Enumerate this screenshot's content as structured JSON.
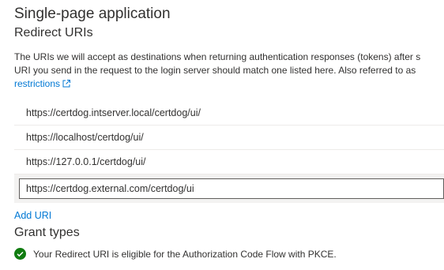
{
  "section": {
    "title": "Single-page application",
    "subtitle": "Redirect URIs"
  },
  "description": {
    "line1": "The URIs we will accept as destinations when returning authentication responses (tokens) after s",
    "line2": "URI you send in the request to the login server should match one listed here. Also referred to as",
    "link_text": "restrictions"
  },
  "redirect_uris": [
    "https://certdog.intserver.local/certdog/ui/",
    "https://localhost/certdog/ui/",
    "https://127.0.0.1/certdog/ui/"
  ],
  "edit_uri_value": "https://certdog.external.com/certdog/ui",
  "add_uri_label": "Add URI",
  "grant_types": {
    "title": "Grant types",
    "status_text": "Your Redirect URI is eligible for the Authorization Code Flow with PKCE.",
    "status_color": "#107c10"
  },
  "icons": {
    "external_link": "external-link-icon",
    "status": "checkmark-circle-icon"
  }
}
